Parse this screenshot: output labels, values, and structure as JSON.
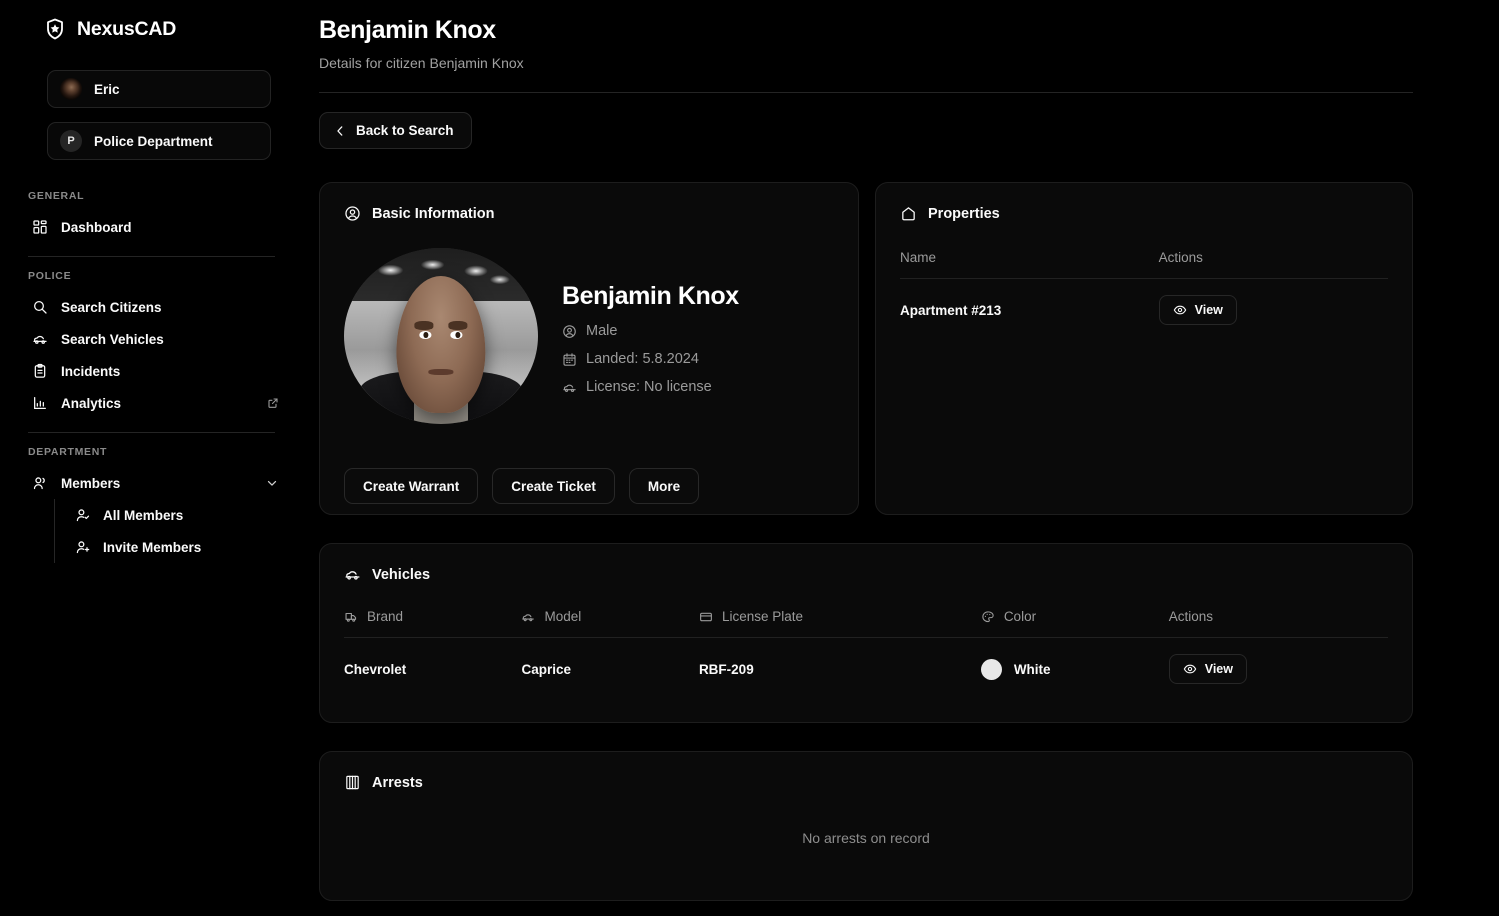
{
  "brand": {
    "name": "NexusCAD",
    "logo_icon": "police-badge-star-icon"
  },
  "sidebar": {
    "user": {
      "label": "Eric",
      "avatar_icon": "user-avatar-photo"
    },
    "org": {
      "label": "Police Department",
      "badge_letter": "P"
    },
    "sections": [
      {
        "title": "GENERAL",
        "items": [
          {
            "label": "Dashboard",
            "icon": "grid-dashboard-icon"
          }
        ]
      },
      {
        "title": "POLICE",
        "items": [
          {
            "label": "Search Citizens",
            "icon": "search-icon"
          },
          {
            "label": "Search Vehicles",
            "icon": "car-icon"
          },
          {
            "label": "Incidents",
            "icon": "clipboard-list-icon"
          },
          {
            "label": "Analytics",
            "icon": "bar-chart-icon",
            "trailing_icon": "external-link-icon"
          }
        ]
      },
      {
        "title": "DEPARTMENT",
        "items": [
          {
            "label": "Members",
            "icon": "users-icon",
            "trailing_icon": "chevron-down-icon"
          }
        ],
        "submenu": [
          {
            "label": "All Members",
            "icon": "user-check-icon"
          },
          {
            "label": "Invite Members",
            "icon": "user-plus-icon"
          }
        ]
      }
    ]
  },
  "header": {
    "title": "Benjamin Knox",
    "subtitle": "Details for citizen Benjamin Knox",
    "back_button": "Back to Search",
    "back_icon": "chevron-left-icon"
  },
  "basic_information": {
    "card_title": "Basic Information",
    "card_icon": "user-circle-icon",
    "name": "Benjamin Knox",
    "gender": "Male",
    "gender_icon": "user-circle-icon",
    "landed": "Landed: 5.8.2024",
    "landed_icon": "calendar-icon",
    "license": "License: No license",
    "license_icon": "car-icon",
    "actions": [
      {
        "label": "Create Warrant"
      },
      {
        "label": "Create Ticket"
      },
      {
        "label": "More"
      }
    ]
  },
  "properties": {
    "card_title": "Properties",
    "card_icon": "home-icon",
    "columns": [
      "Name",
      "Actions"
    ],
    "rows": [
      {
        "name": "Apartment #213",
        "action_label": "View",
        "action_icon": "eye-icon"
      }
    ]
  },
  "vehicles": {
    "card_title": "Vehicles",
    "card_icon": "car-icon",
    "columns": [
      {
        "label": "Brand",
        "icon": "truck-icon"
      },
      {
        "label": "Model",
        "icon": "car-icon"
      },
      {
        "label": "License Plate",
        "icon": "credit-card-icon"
      },
      {
        "label": "Color",
        "icon": "palette-icon"
      },
      {
        "label": "Actions",
        "icon": ""
      }
    ],
    "rows": [
      {
        "brand": "Chevrolet",
        "model": "Caprice",
        "plate": "RBF-209",
        "color": "White",
        "color_hex": "#e8e8e8",
        "action_label": "View",
        "action_icon": "eye-icon"
      }
    ]
  },
  "arrests": {
    "card_title": "Arrests",
    "card_icon": "jail-bars-icon",
    "empty_text": "No arrests on record"
  },
  "colors": {
    "page_bg": "#000000",
    "card_bg": "#0a0a0a",
    "border": "#1d1d1d",
    "text": "#fafafa",
    "muted": "#9b9b9b"
  }
}
